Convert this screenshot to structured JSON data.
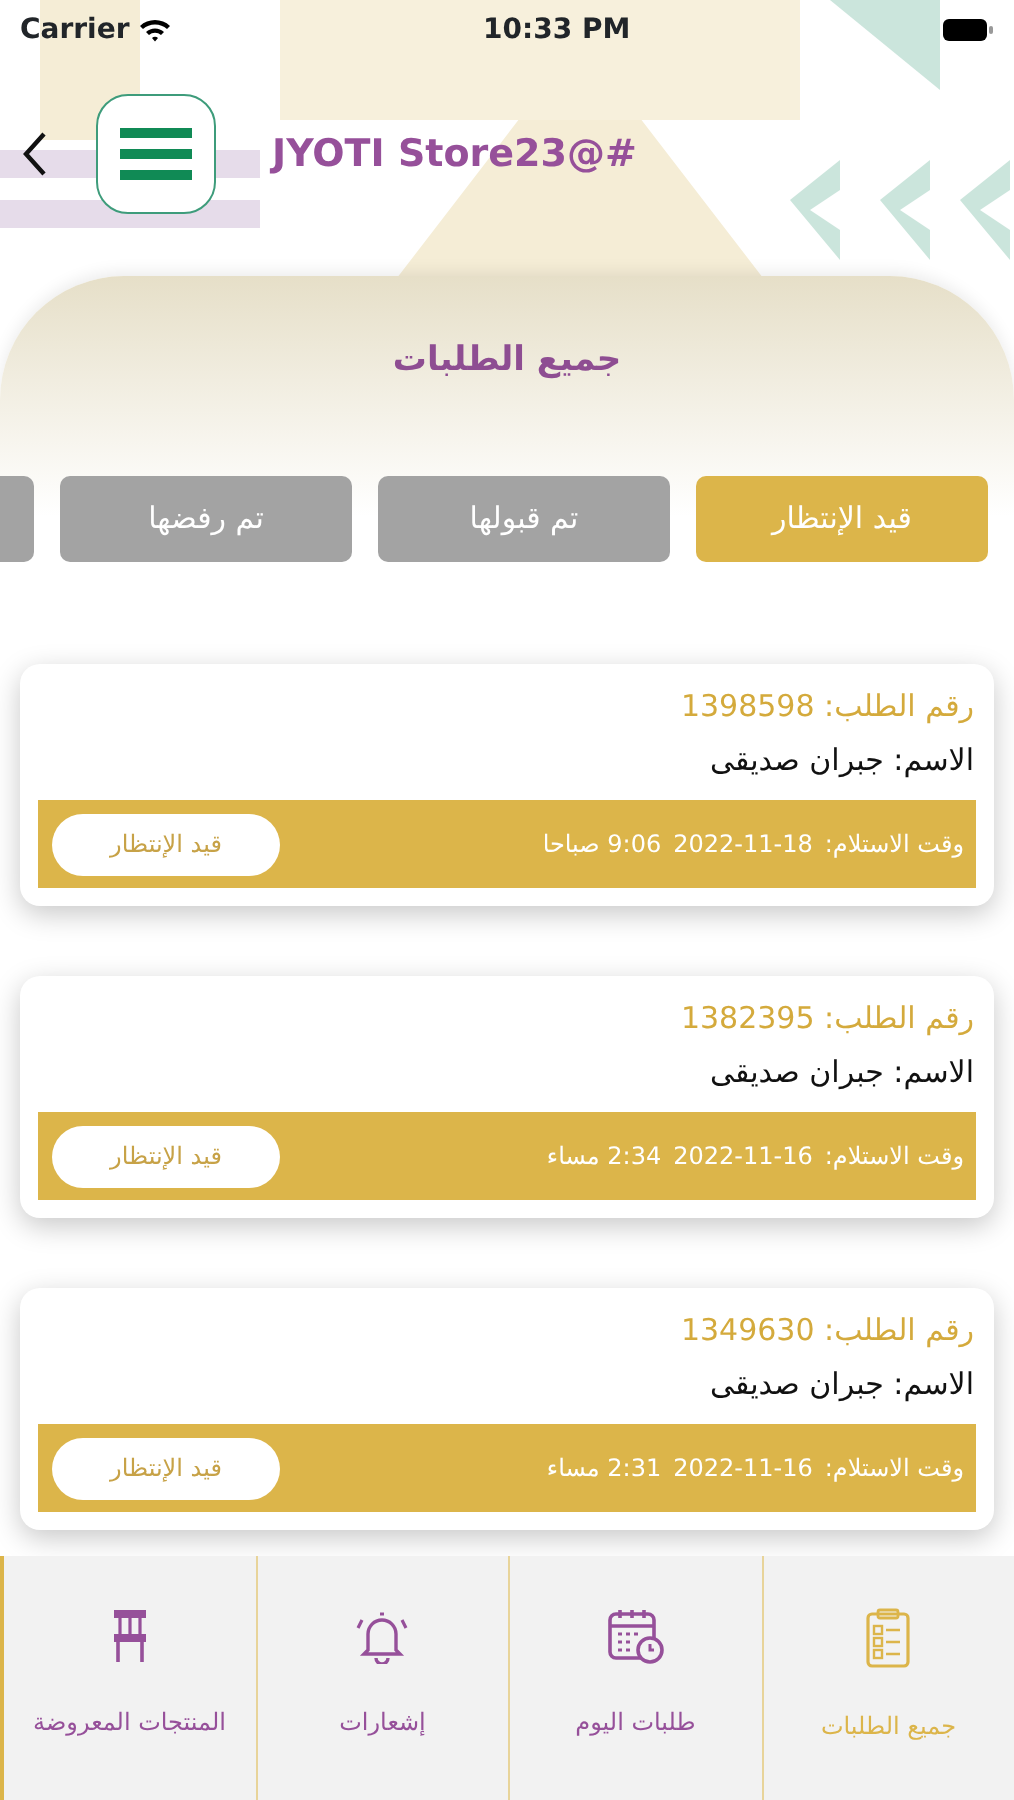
{
  "status_bar": {
    "carrier": "Carrier",
    "time": "10:33 PM"
  },
  "header": {
    "title": "JYOTI Store23@#"
  },
  "panel": {
    "title": "جميع الطلبات"
  },
  "tabs": [
    {
      "label": "قيد الإنتظار",
      "selected": true
    },
    {
      "label": "تم قبولها",
      "selected": false
    },
    {
      "label": "تم رفضها",
      "selected": false
    },
    {
      "selected": false
    }
  ],
  "orders": [
    {
      "number": "رقم الطلب: 1398598",
      "name": "الاسم: جبران صديقى",
      "time_label": "وقت الاستلام:",
      "date": "2022-11-18",
      "time": "9:06 صباحا",
      "status": "قيد الإنتظار"
    },
    {
      "number": "رقم الطلب: 1382395",
      "name": "الاسم: جبران صديقى",
      "time_label": "وقت الاستلام:",
      "date": "2022-11-16",
      "time": "2:34 مساء",
      "status": "قيد الإنتظار"
    },
    {
      "number": "رقم الطلب: 1349630",
      "name": "الاسم: جبران صديقى",
      "time_label": "وقت الاستلام:",
      "date": "2022-11-16",
      "time": "2:31 مساء",
      "status": "قيد الإنتظار"
    }
  ],
  "bottom_nav": [
    {
      "label": "جميع الطلبات",
      "kind": "clipboard",
      "selected": true
    },
    {
      "label": "طلبات اليوم",
      "kind": "calendar",
      "selected": false
    },
    {
      "label": "إشعارات",
      "kind": "bell",
      "selected": false
    },
    {
      "label": "المنتجات المعروضة",
      "kind": "stool",
      "selected": false
    }
  ]
}
